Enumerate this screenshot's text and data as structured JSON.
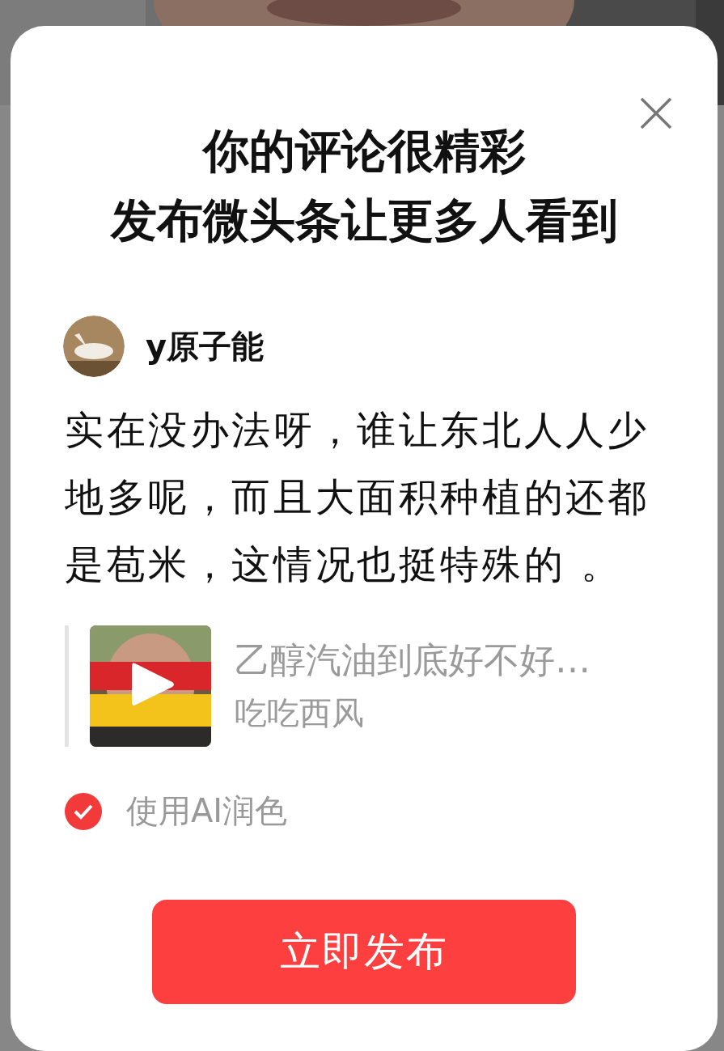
{
  "dialog": {
    "title_lines": [
      "你的评论很精彩",
      "发布微头条让更多人看到"
    ],
    "author": {
      "name": "y原子能"
    },
    "comment": "实在没办法呀，谁让东北人人少地多呢，而且大面积种植的还都是苞米，这情况也挺特殊的 。",
    "quoted_video": {
      "title": "乙醇汽油到底好不好…",
      "author": "吃吃西风"
    },
    "ai_polish": {
      "label": "使用AI润色",
      "checked": true
    },
    "publish_button": "立即发布"
  }
}
